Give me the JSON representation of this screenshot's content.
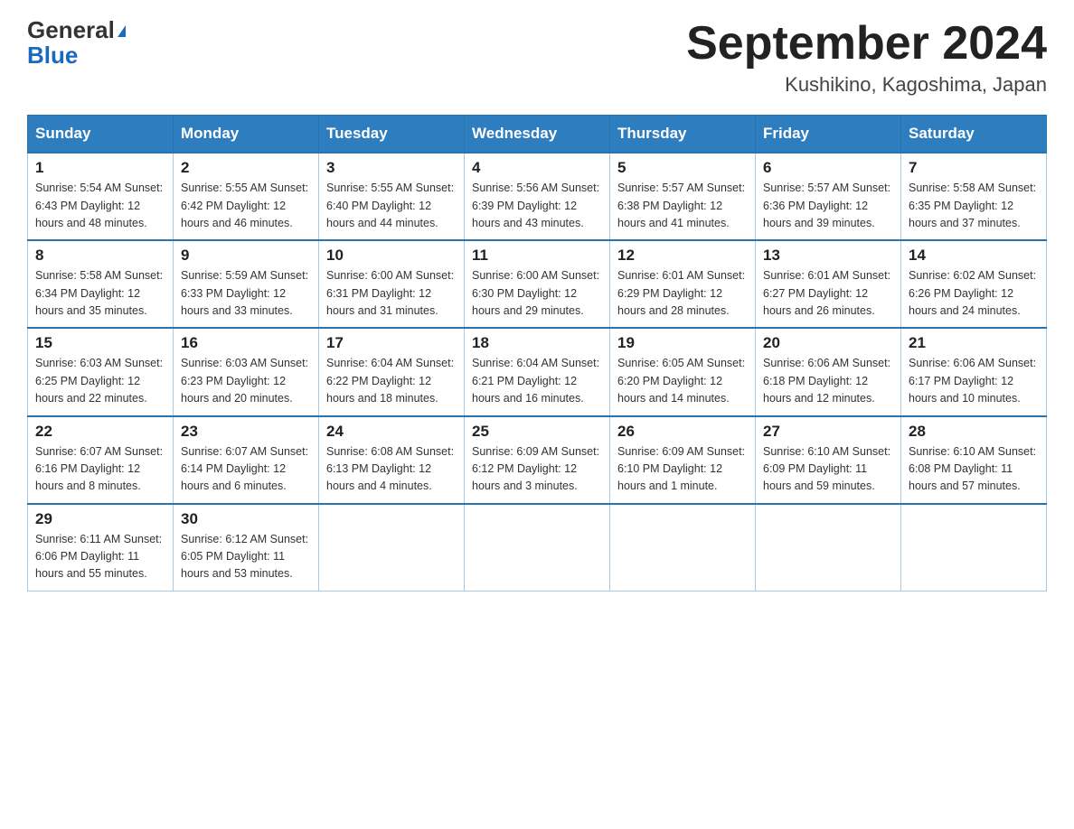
{
  "header": {
    "logo_line1": "General",
    "logo_line2": "Blue",
    "month_year": "September 2024",
    "location": "Kushikino, Kagoshima, Japan"
  },
  "days_of_week": [
    "Sunday",
    "Monday",
    "Tuesday",
    "Wednesday",
    "Thursday",
    "Friday",
    "Saturday"
  ],
  "weeks": [
    [
      {
        "num": "1",
        "info": "Sunrise: 5:54 AM\nSunset: 6:43 PM\nDaylight: 12 hours\nand 48 minutes."
      },
      {
        "num": "2",
        "info": "Sunrise: 5:55 AM\nSunset: 6:42 PM\nDaylight: 12 hours\nand 46 minutes."
      },
      {
        "num": "3",
        "info": "Sunrise: 5:55 AM\nSunset: 6:40 PM\nDaylight: 12 hours\nand 44 minutes."
      },
      {
        "num": "4",
        "info": "Sunrise: 5:56 AM\nSunset: 6:39 PM\nDaylight: 12 hours\nand 43 minutes."
      },
      {
        "num": "5",
        "info": "Sunrise: 5:57 AM\nSunset: 6:38 PM\nDaylight: 12 hours\nand 41 minutes."
      },
      {
        "num": "6",
        "info": "Sunrise: 5:57 AM\nSunset: 6:36 PM\nDaylight: 12 hours\nand 39 minutes."
      },
      {
        "num": "7",
        "info": "Sunrise: 5:58 AM\nSunset: 6:35 PM\nDaylight: 12 hours\nand 37 minutes."
      }
    ],
    [
      {
        "num": "8",
        "info": "Sunrise: 5:58 AM\nSunset: 6:34 PM\nDaylight: 12 hours\nand 35 minutes."
      },
      {
        "num": "9",
        "info": "Sunrise: 5:59 AM\nSunset: 6:33 PM\nDaylight: 12 hours\nand 33 minutes."
      },
      {
        "num": "10",
        "info": "Sunrise: 6:00 AM\nSunset: 6:31 PM\nDaylight: 12 hours\nand 31 minutes."
      },
      {
        "num": "11",
        "info": "Sunrise: 6:00 AM\nSunset: 6:30 PM\nDaylight: 12 hours\nand 29 minutes."
      },
      {
        "num": "12",
        "info": "Sunrise: 6:01 AM\nSunset: 6:29 PM\nDaylight: 12 hours\nand 28 minutes."
      },
      {
        "num": "13",
        "info": "Sunrise: 6:01 AM\nSunset: 6:27 PM\nDaylight: 12 hours\nand 26 minutes."
      },
      {
        "num": "14",
        "info": "Sunrise: 6:02 AM\nSunset: 6:26 PM\nDaylight: 12 hours\nand 24 minutes."
      }
    ],
    [
      {
        "num": "15",
        "info": "Sunrise: 6:03 AM\nSunset: 6:25 PM\nDaylight: 12 hours\nand 22 minutes."
      },
      {
        "num": "16",
        "info": "Sunrise: 6:03 AM\nSunset: 6:23 PM\nDaylight: 12 hours\nand 20 minutes."
      },
      {
        "num": "17",
        "info": "Sunrise: 6:04 AM\nSunset: 6:22 PM\nDaylight: 12 hours\nand 18 minutes."
      },
      {
        "num": "18",
        "info": "Sunrise: 6:04 AM\nSunset: 6:21 PM\nDaylight: 12 hours\nand 16 minutes."
      },
      {
        "num": "19",
        "info": "Sunrise: 6:05 AM\nSunset: 6:20 PM\nDaylight: 12 hours\nand 14 minutes."
      },
      {
        "num": "20",
        "info": "Sunrise: 6:06 AM\nSunset: 6:18 PM\nDaylight: 12 hours\nand 12 minutes."
      },
      {
        "num": "21",
        "info": "Sunrise: 6:06 AM\nSunset: 6:17 PM\nDaylight: 12 hours\nand 10 minutes."
      }
    ],
    [
      {
        "num": "22",
        "info": "Sunrise: 6:07 AM\nSunset: 6:16 PM\nDaylight: 12 hours\nand 8 minutes."
      },
      {
        "num": "23",
        "info": "Sunrise: 6:07 AM\nSunset: 6:14 PM\nDaylight: 12 hours\nand 6 minutes."
      },
      {
        "num": "24",
        "info": "Sunrise: 6:08 AM\nSunset: 6:13 PM\nDaylight: 12 hours\nand 4 minutes."
      },
      {
        "num": "25",
        "info": "Sunrise: 6:09 AM\nSunset: 6:12 PM\nDaylight: 12 hours\nand 3 minutes."
      },
      {
        "num": "26",
        "info": "Sunrise: 6:09 AM\nSunset: 6:10 PM\nDaylight: 12 hours\nand 1 minute."
      },
      {
        "num": "27",
        "info": "Sunrise: 6:10 AM\nSunset: 6:09 PM\nDaylight: 11 hours\nand 59 minutes."
      },
      {
        "num": "28",
        "info": "Sunrise: 6:10 AM\nSunset: 6:08 PM\nDaylight: 11 hours\nand 57 minutes."
      }
    ],
    [
      {
        "num": "29",
        "info": "Sunrise: 6:11 AM\nSunset: 6:06 PM\nDaylight: 11 hours\nand 55 minutes."
      },
      {
        "num": "30",
        "info": "Sunrise: 6:12 AM\nSunset: 6:05 PM\nDaylight: 11 hours\nand 53 minutes."
      },
      {
        "num": "",
        "info": ""
      },
      {
        "num": "",
        "info": ""
      },
      {
        "num": "",
        "info": ""
      },
      {
        "num": "",
        "info": ""
      },
      {
        "num": "",
        "info": ""
      }
    ]
  ]
}
